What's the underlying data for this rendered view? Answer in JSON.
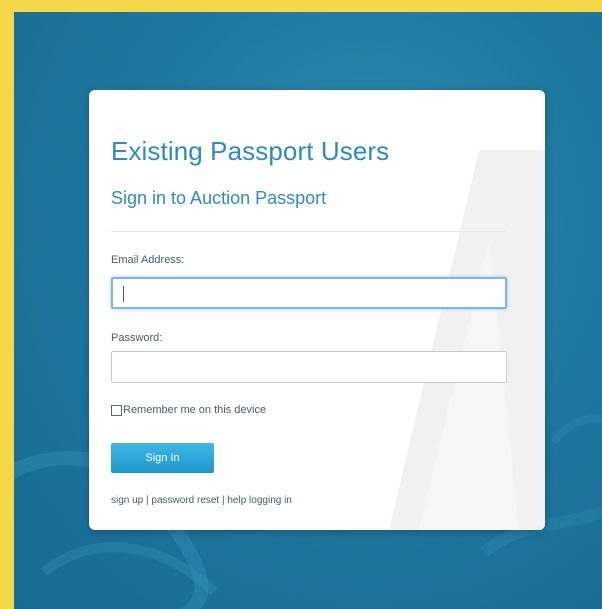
{
  "login": {
    "title": "Existing Passport Users",
    "subtitle": "Sign in to Auction Passport",
    "email_label": "Email Address:",
    "email_value": "",
    "password_label": "Password:",
    "password_value": "",
    "remember_label": "Remember me on this device",
    "remember_checked": false,
    "signin_label": "Sign In",
    "links": {
      "signup": "sign up",
      "separator": " | ",
      "reset": "password reset",
      "help": "help logging in"
    }
  },
  "colors": {
    "frame": "#f5d84a",
    "background": "#1f78a0",
    "accent": "#2f8bbf",
    "button": "#27a6d8"
  },
  "icons": {
    "watermark": "auction-passport-logo-mark"
  }
}
